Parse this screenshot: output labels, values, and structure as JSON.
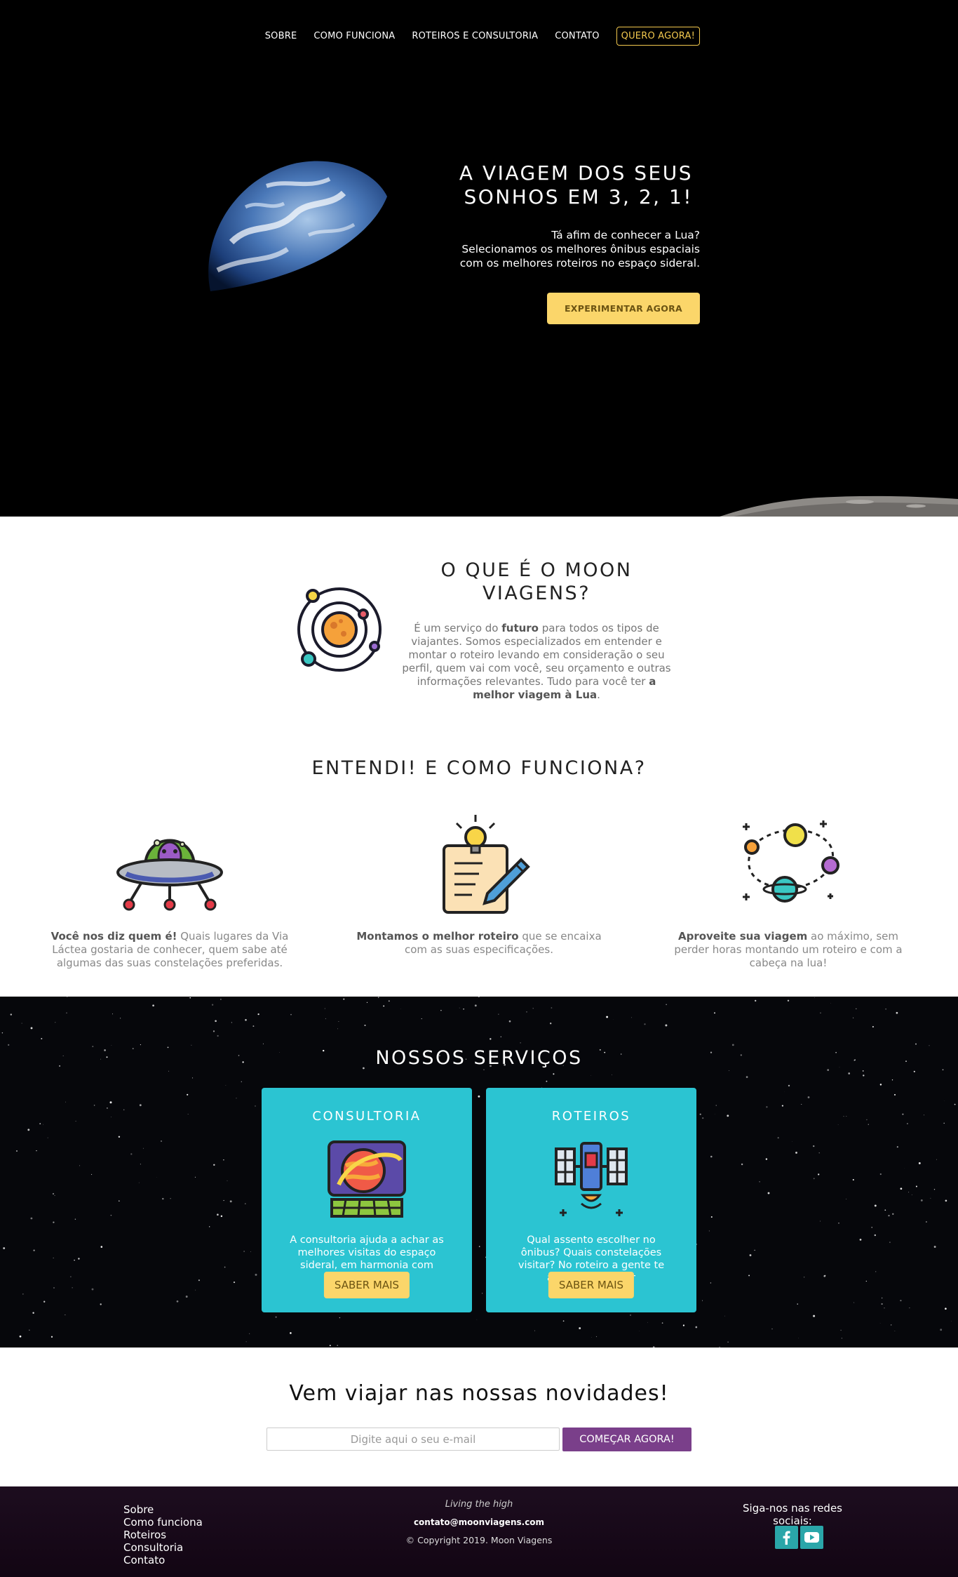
{
  "nav": {
    "items": [
      "SOBRE",
      "COMO FUNCIONA",
      "ROTEIROS E CONSULTORIA",
      "CONTATO"
    ],
    "cta": "QUERO AGORA!"
  },
  "hero": {
    "title_line1": "A VIAGEM DOS SEUS",
    "title_line2": "SONHOS EM 3, 2, 1!",
    "text_line1": "Tá afim de conhecer a Lua?",
    "text_line2": "Selecionamos os melhores ônibus espaciais",
    "text_line3": "com os melhores roteiros no espaço sideral.",
    "button": "EXPERIMENTAR AGORA"
  },
  "about": {
    "title_line1": "O QUE É O MOON",
    "title_line2": "VIAGENS?",
    "text": [
      {
        "t": "É um serviço do ",
        "b": false
      },
      {
        "t": "futuro",
        "b": true
      },
      {
        "t": " para todos os tipos de viajantes. Somos especializados em entender e montar o roteiro levando em consideração o seu perfil, quem vai com você, seu orçamento e outras informações relevantes. Tudo para você ter ",
        "b": false
      },
      {
        "t": "a melhor viagem à Lua",
        "b": true
      },
      {
        "t": ".",
        "b": false
      }
    ]
  },
  "how": {
    "title": "ENTENDI! E COMO FUNCIONA?",
    "steps": [
      {
        "bold": "Você nos diz quem é!",
        "rest": " Quais lugares da Via Láctea gostaria de conhecer, quem sabe até algumas das suas constelações preferidas.",
        "icon": "alien-ufo-icon"
      },
      {
        "bold": "Montamos o melhor roteiro",
        "rest": " que se encaixa com as suas especificações.",
        "icon": "idea-notepad-icon"
      },
      {
        "bold": "Aproveite sua viagem",
        "rest": " ao máximo, sem perder horas montando um roteiro e com a cabeça na lua!",
        "icon": "planets-orbit-icon"
      }
    ]
  },
  "services": {
    "title": "NOSSOS SERVIÇOS",
    "cards": [
      {
        "title": "CONSULTORIA",
        "text": "A consultoria ajuda a achar as melhores visitas do espaço sideral, em harmonia com quem você é.",
        "button": "SABER MAIS",
        "icon": "planet-screen-icon"
      },
      {
        "title": "ROTEIROS",
        "text": "Qual assento escolher no ônibus? Quais constelações visitar? No roteiro a gente te ajuda a descobrir",
        "button": "SABER MAIS",
        "icon": "satellite-icon"
      }
    ]
  },
  "newsletter": {
    "title": "Vem viajar nas nossas novidades!",
    "placeholder": "Digite aqui o seu e-mail",
    "button": "COMEÇAR AGORA!"
  },
  "footer": {
    "links": [
      "Sobre",
      "Como funciona",
      "Roteiros",
      "Consultoria",
      "Contato"
    ],
    "tagline": "Living the high",
    "email": "contato@moonviagens.com",
    "copyright": "© Copyright 2019. Moon Viagens",
    "follow": "Siga-nos nas redes sociais:",
    "social": [
      "facebook-icon",
      "youtube-icon"
    ]
  },
  "colors": {
    "accent_yellow": "#fbd66a",
    "card_cyan": "#2bc4d2",
    "purple_button": "#7a3f8a",
    "social_teal": "#2aa6a9"
  }
}
